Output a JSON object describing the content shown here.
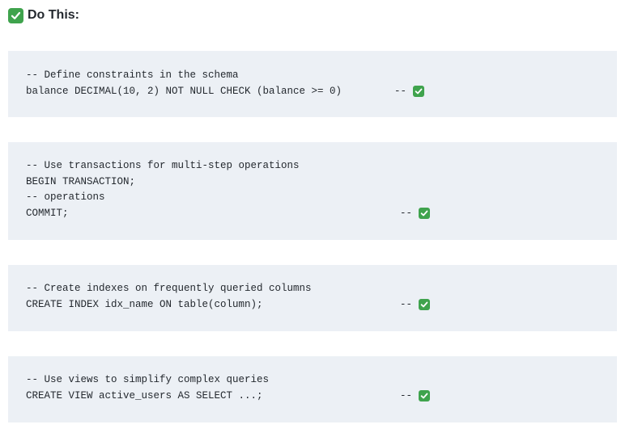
{
  "heading": {
    "icon": "check-mark-button-icon",
    "text": "Do This:"
  },
  "colors": {
    "check_green": "#3fa34d",
    "code_background": "#ecf0f5"
  },
  "blocks": [
    {
      "lines": [
        {
          "code": "-- Define constraints in the schema"
        },
        {
          "code": "balance DECIMAL(10, 2) NOT NULL CHECK (balance >= 0)",
          "suffix": "--"
        }
      ]
    },
    {
      "lines": [
        {
          "code": "-- Use transactions for multi-step operations"
        },
        {
          "code": "BEGIN TRANSACTION;"
        },
        {
          "code": "-- operations"
        },
        {
          "code": "COMMIT;",
          "suffix": "--"
        }
      ]
    },
    {
      "lines": [
        {
          "code": "-- Create indexes on frequently queried columns"
        },
        {
          "code": "CREATE INDEX idx_name ON table(column);",
          "suffix": "--"
        }
      ]
    },
    {
      "lines": [
        {
          "code": "-- Use views to simplify complex queries"
        },
        {
          "code": "CREATE VIEW active_users AS SELECT ...;",
          "suffix": "--"
        }
      ]
    }
  ]
}
